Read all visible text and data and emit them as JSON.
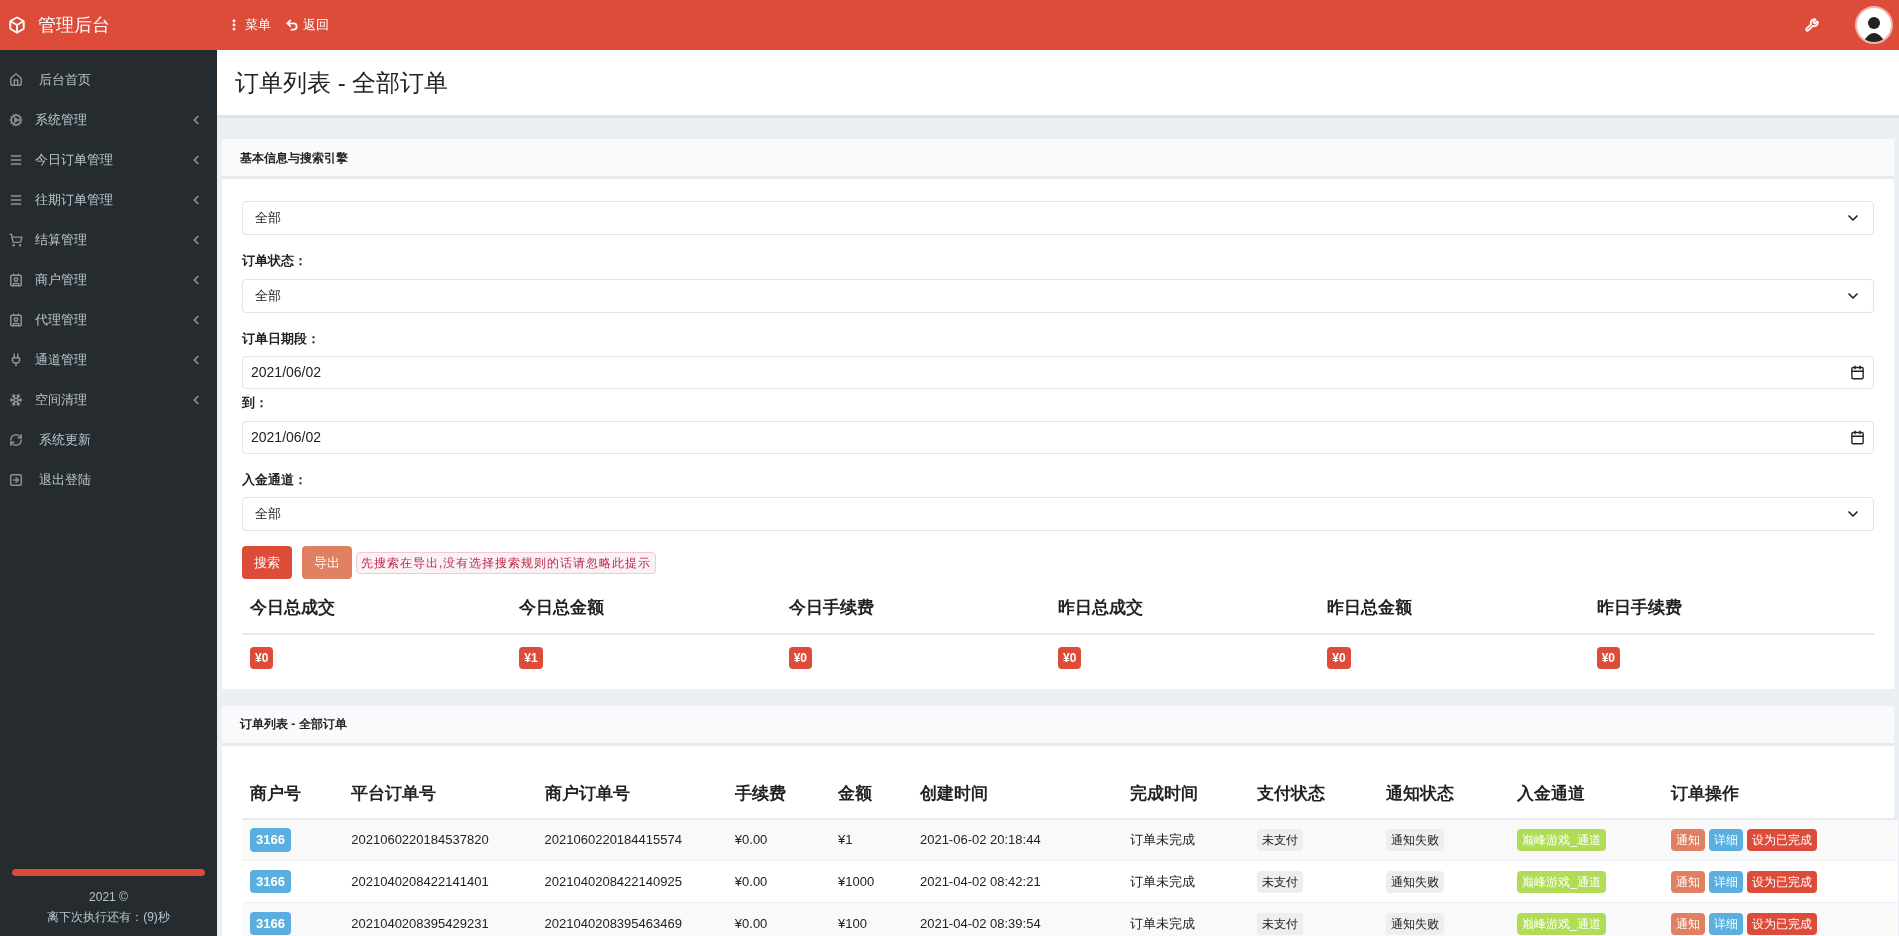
{
  "topbar": {
    "title": "管理后台",
    "menu": "菜单",
    "back": "返回"
  },
  "sidebar": {
    "items": [
      {
        "label": "后台首页",
        "expandable": false
      },
      {
        "label": "系统管理",
        "expandable": true
      },
      {
        "label": "今日订单管理",
        "expandable": true
      },
      {
        "label": "往期订单管理",
        "expandable": true
      },
      {
        "label": "结算管理",
        "expandable": true
      },
      {
        "label": "商户管理",
        "expandable": true
      },
      {
        "label": "代理管理",
        "expandable": true
      },
      {
        "label": "通道管理",
        "expandable": true
      },
      {
        "label": "空间清理",
        "expandable": true
      },
      {
        "label": "系统更新",
        "expandable": false
      },
      {
        "label": "退出登陆",
        "expandable": false
      }
    ],
    "progress": {
      "level": 1
    },
    "footer": "2021 ©",
    "countdown": "离下次执行还有：(9)秒"
  },
  "page_title": "订单列表 - 全部订单",
  "search_card": {
    "title": "基本信息与搜索引擎",
    "fields": [
      {
        "kind": "select",
        "value": "全部"
      },
      {
        "kind": "select",
        "label": "订单状态：",
        "value": "全部"
      },
      {
        "kind": "date",
        "label": "订单日期段：",
        "value": "2021/06/02"
      },
      {
        "kind": "date",
        "label": "到：",
        "value": "2021/06/02"
      },
      {
        "kind": "select",
        "label": "入金通道：",
        "value": "全部"
      }
    ],
    "buttons": [
      "搜索",
      "导出"
    ],
    "hint": "先搜索在导出,没有选择搜索规则的话请忽略此提示",
    "stats": [
      {
        "label": "今日总成交",
        "value": "¥0"
      },
      {
        "label": "今日总金额",
        "value": "¥1"
      },
      {
        "label": "今日手续费",
        "value": "¥0"
      },
      {
        "label": "昨日总成交",
        "value": "¥0"
      },
      {
        "label": "昨日总金额",
        "value": "¥0"
      },
      {
        "label": "昨日手续费",
        "value": "¥0"
      }
    ]
  },
  "table_card": {
    "title": "订单列表 - 全部订单",
    "columns": [
      "商户号",
      "平台订单号",
      "商户订单号",
      "手续费",
      "金额",
      "创建时间",
      "完成时间",
      "支付状态",
      "通知状态",
      "入金通道",
      "订单操作"
    ],
    "rows": [
      {
        "merchant": "3166",
        "platform_no": "2021060220184537820",
        "merchant_no": "2021060220184415574",
        "fee": "¥0.00",
        "amount": "¥1",
        "created": "2021-06-02 20:18:44",
        "finished": "订单未完成",
        "pay_status": "未支付",
        "notify_status": "通知失败",
        "channel": "巅峰游戏_通道",
        "actions": [
          "通知",
          "详细",
          "设为已完成"
        ]
      },
      {
        "merchant": "3166",
        "platform_no": "2021040208422141401",
        "merchant_no": "2021040208422140925",
        "fee": "¥0.00",
        "amount": "¥1000",
        "created": "2021-04-02 08:42:21",
        "finished": "订单未完成",
        "pay_status": "未支付",
        "notify_status": "通知失败",
        "channel": "巅峰游戏_通道",
        "actions": [
          "通知",
          "详细",
          "设为已完成"
        ]
      },
      {
        "merchant": "3166",
        "platform_no": "2021040208395429231",
        "merchant_no": "2021040208395463469",
        "fee": "¥0.00",
        "amount": "¥100",
        "created": "2021-04-02 08:39:54",
        "finished": "订单未完成",
        "pay_status": "未支付",
        "notify_status": "通知失败",
        "channel": "巅峰游戏_通道",
        "actions": [
          "通知",
          "详细",
          "设为已完成"
        ]
      }
    ]
  }
}
